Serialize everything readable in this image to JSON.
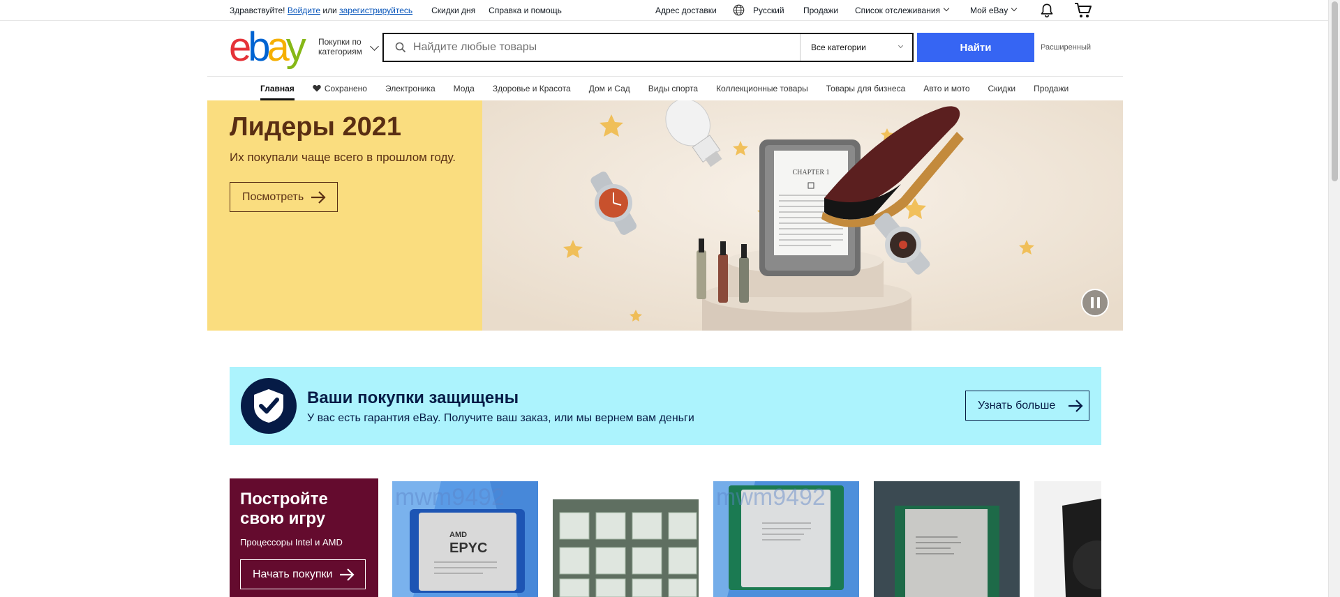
{
  "topbar": {
    "greeting": "Здравствуйте!",
    "signin": "Войдите",
    "or": "или",
    "register": "зарегистрируйтесь",
    "daily_deals": "Скидки дня",
    "help": "Справка и помощь",
    "ship_to": "Адрес доставки",
    "language": "Русский",
    "sell": "Продажи",
    "watchlist": "Список отслеживания",
    "my_ebay": "Мой eBay"
  },
  "header": {
    "logo": {
      "e": "e",
      "b": "b",
      "a": "a",
      "y": "y"
    },
    "shop_by_category_line1": "Покупки по",
    "shop_by_category_line2": "категориям",
    "search_placeholder": "Найдите любые товары",
    "category_select": "Все категории",
    "search_button": "Найти",
    "advanced": "Расширенный"
  },
  "nav": {
    "items": [
      {
        "label": "Главная"
      },
      {
        "label": "Сохранено"
      },
      {
        "label": "Электроника"
      },
      {
        "label": "Мода"
      },
      {
        "label": "Здоровье и Красота"
      },
      {
        "label": "Дом и Сад"
      },
      {
        "label": "Виды спорта"
      },
      {
        "label": "Коллекционные товары"
      },
      {
        "label": "Товары для бизнеса"
      },
      {
        "label": "Авто и мото"
      },
      {
        "label": "Скидки"
      },
      {
        "label": "Продажи"
      }
    ]
  },
  "hero": {
    "title": "Лидеры 2021",
    "subtitle": "Их покупали чаще всего в прошлом году.",
    "button": "Посмотреть",
    "book_heading": "CHAPTER 1"
  },
  "protection": {
    "title": "Ваши покупки защищены",
    "subtitle": "У вас есть гарантия eBay. Получите ваш заказ, или мы вернем вам деньги",
    "button": "Узнать больше"
  },
  "games_tile": {
    "title": "Постройте свою игру",
    "subtitle": "Процессоры Intel и AMD",
    "button": "Начать покупки"
  },
  "products": {
    "watermark": "mwm9492",
    "amd_brand": "AMD",
    "amd_model": "EPYC"
  },
  "colors": {
    "accent_blue": "#3665f3",
    "hero_yellow": "#fadd7f",
    "hero_text": "#592e13",
    "protect_bg": "#acf3fd",
    "protect_text": "#061b46",
    "games_bg": "#640b2e"
  }
}
